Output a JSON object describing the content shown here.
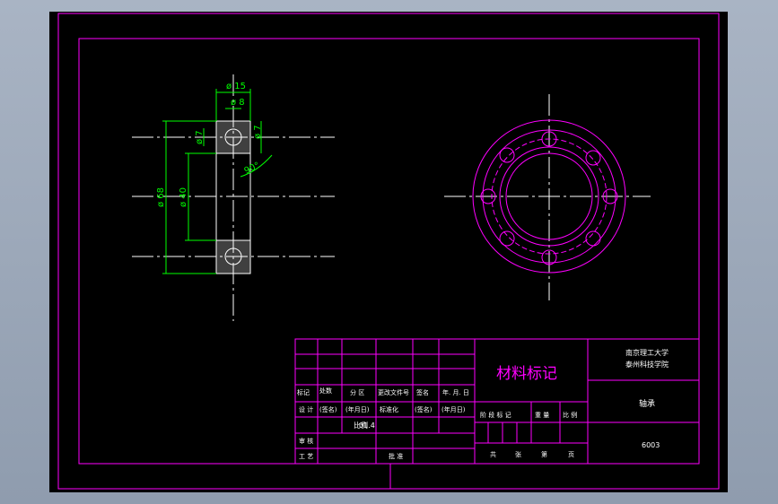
{
  "colors": {
    "background": "#000000",
    "frame": "#ff00ff",
    "object_lines": "#ffffff",
    "dimensions": "#00ff00",
    "window": "#9aa6b8"
  },
  "dimensions": {
    "d15": "ø 15",
    "d8": "ø 8",
    "d7_left": "ø 7",
    "d7_right": "ø 7",
    "d68": "ø 68",
    "d40": "ø 40",
    "angle": "90°"
  },
  "title_block": {
    "material_mark": "材料标记",
    "school_line1": "南京理工大学",
    "school_line2": "泰州科技学院",
    "part_name": "轴承",
    "drawing_number": "6003",
    "header_row": [
      "标记",
      "处数",
      "分 区",
      "更改文件号",
      "签名",
      "年. 月. 日"
    ],
    "design_row": [
      "设 计",
      "(签名)",
      "(年月日)",
      "标准化",
      "(签名)",
      "(年月日)"
    ],
    "stage_row": [
      "阶 段 标 记",
      "重 量",
      "比 例"
    ],
    "sheet_row": [
      "共",
      "张",
      "第",
      "页"
    ],
    "checker": "审 核",
    "process": "工 艺",
    "approve": "批 准",
    "scale_label": "比例",
    "scale_value": "01.4"
  }
}
